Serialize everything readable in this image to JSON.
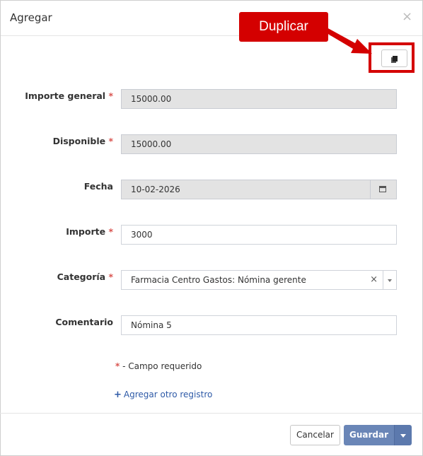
{
  "dialog": {
    "title": "Agregar",
    "close_symbol": "×"
  },
  "annotation": {
    "callout_label": "Duplicar",
    "duplicate_icon": "duplicate-icon",
    "color": "#d40000"
  },
  "form": {
    "required_mark": "*",
    "fields": {
      "importe_general": {
        "label": "Importe general",
        "value": "15000.00",
        "required": true
      },
      "disponible": {
        "label": "Disponible",
        "value": "15000.00",
        "required": true
      },
      "fecha": {
        "label": "Fecha",
        "value": "10-02-2026",
        "icon": "calendar-icon"
      },
      "importe": {
        "label": "Importe",
        "value": "3000",
        "required": true
      },
      "categoria": {
        "label": "Categoría",
        "value": "Farmacia Centro Gastos: Nómina gerente",
        "clear_symbol": "×",
        "required": true
      },
      "comentario": {
        "label": "Comentario",
        "value": "Nómina 5"
      }
    },
    "required_note": "- Campo requerido",
    "add_link": {
      "plus": "+",
      "label": "Agregar otro registro"
    }
  },
  "footer": {
    "cancel_label": "Cancelar",
    "save_label": "Guardar",
    "accent_color": "#6a86b7"
  }
}
